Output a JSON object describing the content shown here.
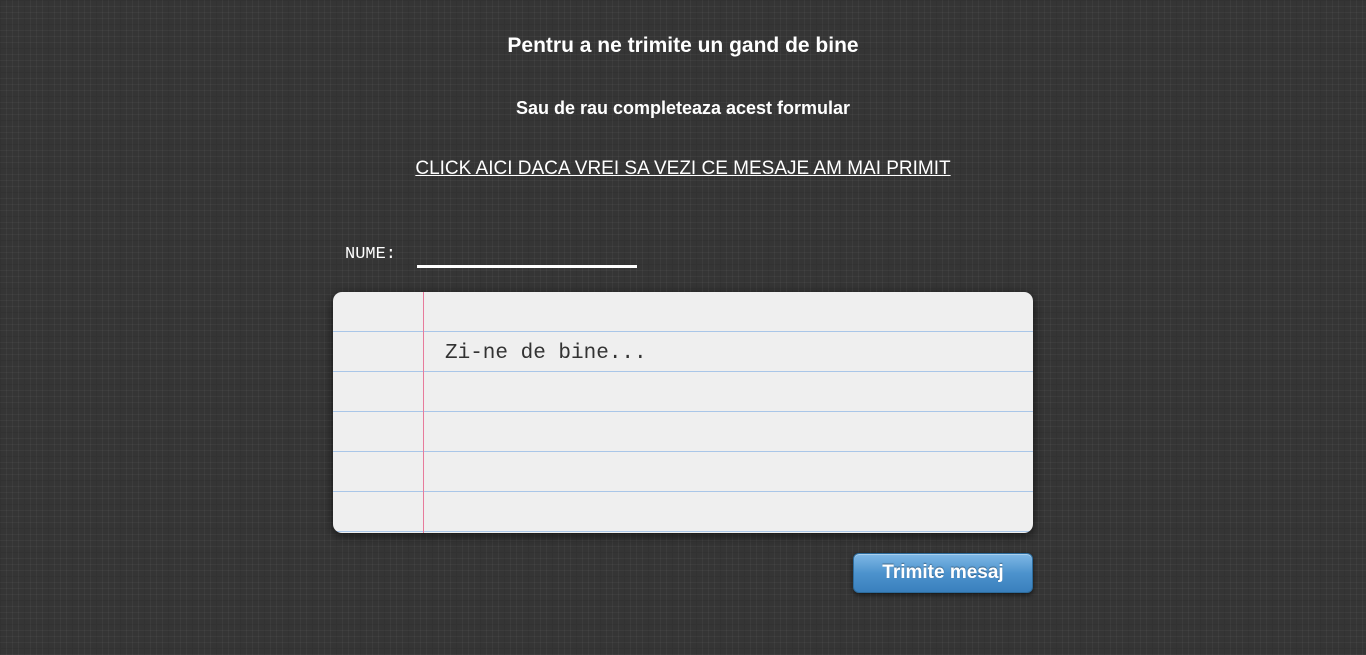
{
  "header": {
    "title": "Pentru a ne trimite un gand de bine",
    "subtitle": "Sau de rau completeaza acest formular",
    "view_messages_link": "CLICK AICI DACA VREI SA VEZI CE MESAJE AM MAI PRIMIT"
  },
  "form": {
    "name_label": "NUME:",
    "name_value": "",
    "message_placeholder": "Zi-ne de bine...",
    "message_value": "",
    "submit_label": "Trimite mesaj"
  },
  "colors": {
    "background": "#353535",
    "text": "#ffffff",
    "paper": "#efefef",
    "paper_rule": "#a9c6e8",
    "paper_margin": "#e77a9b",
    "button": "#4d93cd"
  }
}
